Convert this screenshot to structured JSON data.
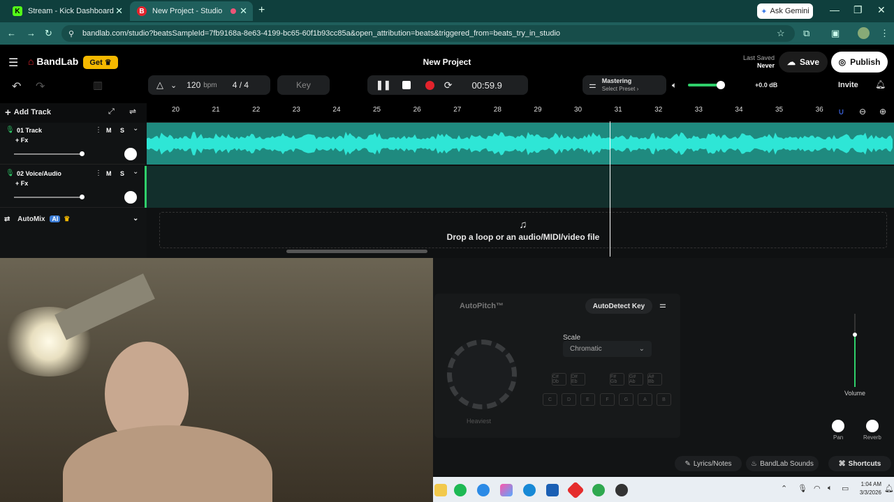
{
  "browser": {
    "tabs": [
      {
        "label": "Stream - Kick Dashboard",
        "favicon": "K"
      },
      {
        "label": "New Project - Studio",
        "favicon": "B"
      }
    ],
    "url": "bandlab.com/studio?beatsSampleId=7fb9168a-8e63-4199-bc65-60f1b93cc85a&open_attribution=beats&triggered_from=beats_try_in_studio",
    "gemini_label": "Ask Gemini"
  },
  "header": {
    "brand": "BandLab",
    "get_label": "Get",
    "project_title": "New Project",
    "last_saved_label": "Last Saved",
    "last_saved_value": "Never",
    "save_label": "Save",
    "publish_label": "Publish"
  },
  "transport": {
    "bpm_value": "120",
    "bpm_unit": "bpm",
    "time_sig": "4 / 4",
    "key_label": "Key",
    "time": "00:59.9",
    "mastering_label": "Mastering",
    "preset_label": "Select Preset ›",
    "gain": "+0.0 dB",
    "invite_label": "Invite"
  },
  "ruler": {
    "numbers": [
      "20",
      "21",
      "22",
      "23",
      "24",
      "25",
      "26",
      "27",
      "28",
      "29",
      "30",
      "31",
      "32",
      "33",
      "34",
      "35",
      "36"
    ]
  },
  "tracks": [
    {
      "name": "01  Track",
      "fx": "+ Fx",
      "mute": "M",
      "solo": "S"
    },
    {
      "name": "02  Voice/Audio",
      "fx": "+ Fx",
      "mute": "M",
      "solo": "S"
    }
  ],
  "add_track_label": "Add Track",
  "automix": {
    "label": "AutoMix",
    "badge": "AI"
  },
  "dropzone_label": "Drop a loop or an audio/MIDI/video file",
  "autopitch": {
    "title": "AutoPitch™",
    "autodetect_label": "AutoDetect Key",
    "scale_label": "Scale",
    "scale_value": "Chromatic",
    "knob_label": "Heaviest",
    "sharps": [
      "C#\nDb",
      "D#\nEb",
      "F#\nGb",
      "G#\nAb",
      "A#\nBb"
    ],
    "naturals": [
      "C",
      "D",
      "E",
      "F",
      "G",
      "A",
      "B"
    ]
  },
  "mixer": {
    "volume_label": "Volume",
    "pan_label": "Pan",
    "reverb_label": "Reverb"
  },
  "footer": {
    "lyrics_label": "Lyrics/Notes",
    "sounds_label": "BandLab Sounds",
    "shortcuts_label": "Shortcuts"
  },
  "taskbar": {
    "time": "1:04 AM",
    "date": "3/3/2026"
  },
  "colors": {
    "accent_teal": "#1fd1c0",
    "record_red": "#e3232c",
    "get_yellow": "#f5b900"
  }
}
